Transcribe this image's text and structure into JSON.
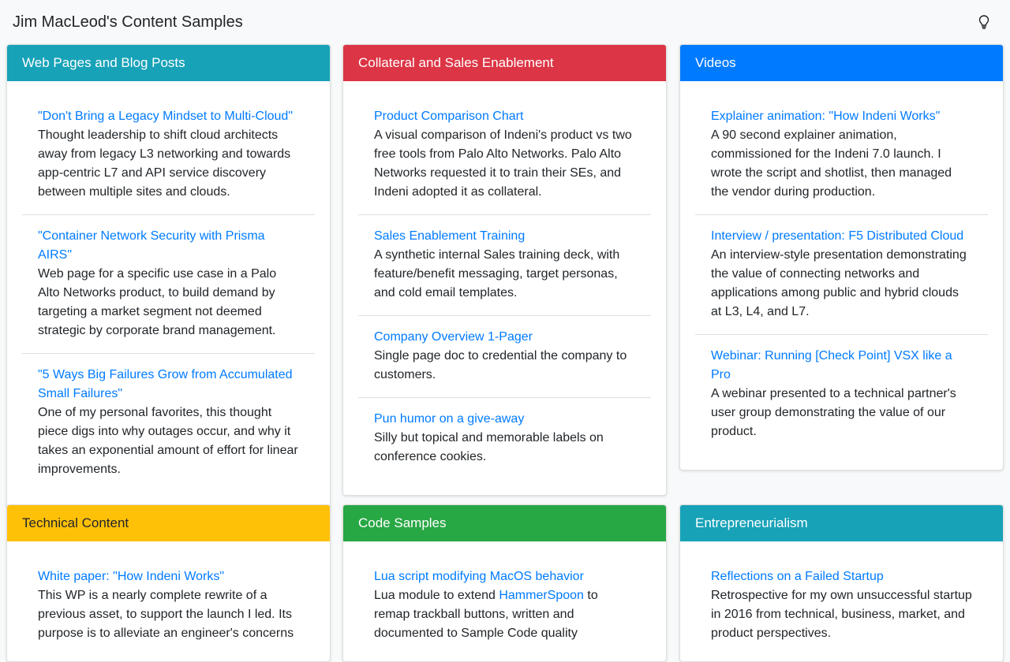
{
  "site": {
    "title": "Jim MacLeod's Content Samples",
    "theme_icon": "lightbulb-icon"
  },
  "cards": [
    {
      "title": "Web Pages and Blog Posts",
      "color": "#17a2b8",
      "items": [
        {
          "link": "\"Don't Bring a Legacy Mindset to Multi-Cloud\"",
          "desc": "Thought leadership to shift cloud architects away from legacy L3 networking and towards app-centric L7 and API service discovery between multiple sites and clouds."
        },
        {
          "link": "\"Container Network Security with Prisma AIRS\"",
          "desc": "Web page for a specific use case in a Palo Alto Networks product, to build demand by targeting a market segment not deemed strategic by corporate brand management."
        },
        {
          "link": "\"5 Ways Big Failures Grow from Accumulated Small Failures\"",
          "desc": "One of my personal favorites, this thought piece digs into why outages occur, and why it takes an exponential amount of effort for linear improvements."
        }
      ]
    },
    {
      "title": "Collateral and Sales Enablement",
      "color": "#dc3545",
      "items": [
        {
          "link": "Product Comparison Chart",
          "desc": "A visual comparison of Indeni's product vs two free tools from Palo Alto Networks. Palo Alto Networks requested it to train their SEs, and Indeni adopted it as collateral."
        },
        {
          "link": "Sales Enablement Training",
          "desc": "A synthetic internal Sales training deck, with feature/benefit messaging, target personas, and cold email templates."
        },
        {
          "link": "Company Overview 1-Pager",
          "desc": "Single page doc to credential the company to customers."
        },
        {
          "link": "Pun humor on a give-away",
          "desc": "Silly but topical and memorable labels on conference cookies."
        }
      ]
    },
    {
      "title": "Videos",
      "color": "#007bff",
      "items": [
        {
          "link": "Explainer animation: \"How Indeni Works\"",
          "desc": "A 90 second explainer animation, commissioned for the Indeni 7.0 launch. I wrote the script and shotlist, then managed the vendor during production."
        },
        {
          "link": "Interview / presentation: F5 Distributed Cloud",
          "desc": "An interview-style presentation demonstrating the value of connecting networks and applications among public and hybrid clouds at L3, L4, and L7."
        },
        {
          "link": "Webinar: Running [Check Point] VSX like a Pro",
          "desc": "A webinar presented to a technical partner's user group demonstrating the value of our product."
        }
      ]
    },
    {
      "title": "Technical Content",
      "color": "#ffc107",
      "items": [
        {
          "link": "White paper: \"How Indeni Works\"",
          "desc": "This WP is a nearly complete rewrite of a previous asset, to support the launch I led. Its purpose is to alleviate an engineer's concerns"
        }
      ]
    },
    {
      "title": "Code Samples",
      "color": "#28a745",
      "items": [
        {
          "link": "Lua script modifying MacOS behavior",
          "desc_before": "Lua module to extend ",
          "desc_link": "HammerSpoon",
          "desc_after": " to remap trackball buttons, written and documented to Sample Code quality"
        }
      ]
    },
    {
      "title": "Entrepreneurialism",
      "color": "#17a2b8",
      "items": [
        {
          "link": "Reflections on a Failed Startup",
          "desc": "Retrospective for my own unsuccessful startup in 2016 from technical, business, market, and product perspectives."
        }
      ]
    }
  ]
}
